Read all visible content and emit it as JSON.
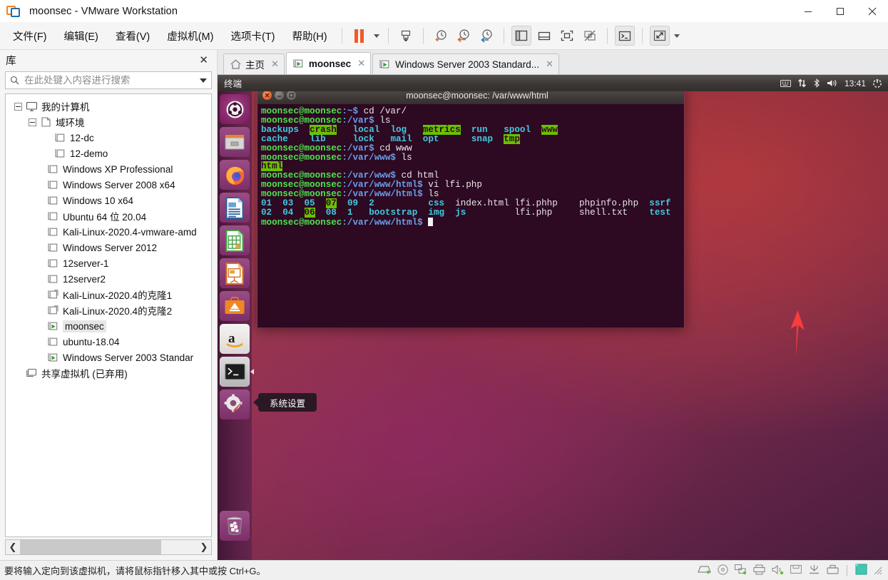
{
  "window": {
    "title": "moonsec - VMware Workstation",
    "logo_icon": "vmware-logo-icon",
    "controls": {
      "minimize": "minimize-icon",
      "maximize": "maximize-icon",
      "close": "close-icon"
    }
  },
  "menubar": {
    "items": [
      {
        "label": "文件(F)",
        "name": "menu-file"
      },
      {
        "label": "编辑(E)",
        "name": "menu-edit"
      },
      {
        "label": "查看(V)",
        "name": "menu-view"
      },
      {
        "label": "虚拟机(M)",
        "name": "menu-vm"
      },
      {
        "label": "选项卡(T)",
        "name": "menu-tabs"
      },
      {
        "label": "帮助(H)",
        "name": "menu-help"
      }
    ],
    "toolbar": [
      {
        "name": "suspend-button",
        "icon": "pause-icon"
      },
      {
        "name": "power-dropdown",
        "icon": "chevron-down-icon"
      },
      {
        "name": "snapshot-take-button",
        "icon": "snapshot-save-icon"
      },
      {
        "name": "snapshot-manager-button",
        "icon": "clock-plus-icon"
      },
      {
        "name": "revert-snapshot-button",
        "icon": "clock-back-icon"
      },
      {
        "name": "manage-snapshots-button",
        "icon": "clock-wrench-icon"
      },
      {
        "name": "show-library-button",
        "icon": "panel-left-icon"
      },
      {
        "name": "show-thumbnail-bar-button",
        "icon": "panel-bottom-icon"
      },
      {
        "name": "fullscreen-button",
        "icon": "fullscreen-icon"
      },
      {
        "name": "unity-mode-button",
        "icon": "unity-off-icon"
      },
      {
        "name": "console-button",
        "icon": "terminal-icon"
      },
      {
        "name": "stretch-button",
        "icon": "expand-arrows-icon"
      },
      {
        "name": "stretch-dropdown",
        "icon": "chevron-down-icon"
      }
    ]
  },
  "library": {
    "title": "库",
    "close_icon": "close-icon",
    "search": {
      "placeholder": "在此处键入内容进行搜索",
      "value": "",
      "icon": "search-icon",
      "dropdown_icon": "chevron-down-icon"
    },
    "tree": [
      {
        "label": "我的计算机",
        "depth": 0,
        "icon": "computer-icon",
        "expander": "minus",
        "selected": false
      },
      {
        "label": "域环境",
        "depth": 1,
        "icon": "folder-icon",
        "expander": "minus",
        "selected": false
      },
      {
        "label": "12-dc",
        "depth": 2,
        "icon": "vm-icon",
        "expander": "none",
        "selected": false
      },
      {
        "label": "12-demo",
        "depth": 2,
        "icon": "vm-icon",
        "expander": "none",
        "selected": false
      },
      {
        "label": "Windows XP Professional",
        "depth": 1.5,
        "icon": "vm-icon",
        "expander": "none",
        "selected": false
      },
      {
        "label": "Windows Server 2008 x64",
        "depth": 1.5,
        "icon": "vm-icon",
        "expander": "none",
        "selected": false
      },
      {
        "label": "Windows 10 x64",
        "depth": 1.5,
        "icon": "vm-icon",
        "expander": "none",
        "selected": false
      },
      {
        "label": "Ubuntu 64 位 20.04",
        "depth": 1.5,
        "icon": "vm-icon",
        "expander": "none",
        "selected": false
      },
      {
        "label": "Kali-Linux-2020.4-vmware-amd",
        "depth": 1.5,
        "icon": "vm-icon",
        "expander": "none",
        "selected": false
      },
      {
        "label": "Windows Server 2012",
        "depth": 1.5,
        "icon": "vm-icon",
        "expander": "none",
        "selected": false
      },
      {
        "label": "12server-1",
        "depth": 1.5,
        "icon": "vm-icon",
        "expander": "none",
        "selected": false
      },
      {
        "label": "12server2",
        "depth": 1.5,
        "icon": "vm-icon",
        "expander": "none",
        "selected": false
      },
      {
        "label": "Kali-Linux-2020.4的克隆1",
        "depth": 1.5,
        "icon": "vm-clone-icon",
        "expander": "none",
        "selected": false
      },
      {
        "label": "Kali-Linux-2020.4的克隆2",
        "depth": 1.5,
        "icon": "vm-clone-icon",
        "expander": "none",
        "selected": false
      },
      {
        "label": "moonsec",
        "depth": 1.5,
        "icon": "vm-running-icon",
        "expander": "none",
        "selected": true
      },
      {
        "label": "ubuntu-18.04",
        "depth": 1.5,
        "icon": "vm-icon",
        "expander": "none",
        "selected": false
      },
      {
        "label": "Windows Server 2003 Standar",
        "depth": 1.5,
        "icon": "vm-running-icon",
        "expander": "none",
        "selected": false
      },
      {
        "label": "共享虚拟机 (已弃用)",
        "depth": 0,
        "icon": "shared-vm-icon",
        "expander": "none",
        "selected": false
      }
    ],
    "hscroll": {
      "left_icon": "chevron-left-icon",
      "right_icon": "chevron-right-icon"
    }
  },
  "tabs": [
    {
      "label": "主页",
      "icon": "home-icon",
      "active": false,
      "close_icon": "close-icon"
    },
    {
      "label": "moonsec",
      "icon": "vm-running-icon",
      "active": true,
      "close_icon": "close-icon"
    },
    {
      "label": "Windows Server 2003 Standard...",
      "icon": "vm-running-icon",
      "active": false,
      "close_icon": "close-icon"
    }
  ],
  "guest": {
    "panel": {
      "app_name": "终端",
      "indicators": [
        {
          "name": "keyboard-indicator-icon"
        },
        {
          "name": "network-indicator-icon"
        },
        {
          "name": "bluetooth-indicator-icon"
        },
        {
          "name": "volume-indicator-icon"
        }
      ],
      "clock": "13:41",
      "session_icon": "power-gear-icon"
    },
    "launcher": [
      {
        "name": "launcher-ubuntu-dash",
        "icon": "ubuntu-dash-icon"
      },
      {
        "name": "launcher-files",
        "icon": "files-icon"
      },
      {
        "name": "launcher-firefox",
        "icon": "firefox-icon"
      },
      {
        "name": "launcher-libreoffice-writer",
        "icon": "writer-icon"
      },
      {
        "name": "launcher-libreoffice-calc",
        "icon": "calc-icon"
      },
      {
        "name": "launcher-libreoffice-impress",
        "icon": "impress-icon"
      },
      {
        "name": "launcher-ubuntu-software",
        "icon": "software-center-icon"
      },
      {
        "name": "launcher-amazon",
        "icon": "amazon-icon"
      },
      {
        "name": "launcher-terminal",
        "icon": "terminal-icon"
      },
      {
        "name": "launcher-system-settings",
        "icon": "system-settings-icon"
      },
      {
        "name": "launcher-trash",
        "icon": "trash-icon"
      }
    ],
    "tooltip": "系统设置",
    "terminal": {
      "title": "moonsec@moonsec: /var/www/html",
      "buttons": {
        "close": "close-icon",
        "minimize": "minimize-icon",
        "maximize": "maximize-icon"
      },
      "lines": [
        {
          "id": "l1",
          "prompt": "moonsec@moonsec",
          "path": ":~$",
          "cmd": " cd /var/"
        },
        {
          "id": "l2",
          "prompt": "moonsec@moonsec",
          "path": ":/var$",
          "cmd": " ls"
        },
        {
          "id": "l3",
          "type": "cols_var_1"
        },
        {
          "id": "l4",
          "type": "cols_var_2"
        },
        {
          "id": "l5",
          "prompt": "moonsec@moonsec",
          "path": ":/var$",
          "cmd": " cd www"
        },
        {
          "id": "l6",
          "prompt": "moonsec@moonsec",
          "path": ":/var/www$",
          "cmd": " ls"
        },
        {
          "id": "l7",
          "type": "html_dir"
        },
        {
          "id": "l8",
          "prompt": "moonsec@moonsec",
          "path": ":/var/www$",
          "cmd": " cd html"
        },
        {
          "id": "l9",
          "prompt": "moonsec@moonsec",
          "path": ":/var/www/html$",
          "cmd": " vi lfi.php"
        },
        {
          "id": "l10",
          "prompt": "moonsec@moonsec",
          "path": ":/var/www/html$",
          "cmd": " ls"
        },
        {
          "id": "l11",
          "type": "cols_html_1"
        },
        {
          "id": "l12",
          "type": "cols_html_2"
        },
        {
          "id": "l13",
          "prompt": "moonsec@moonsec",
          "path": ":/var/www/html$",
          "cmd": " ",
          "cursor": true
        }
      ],
      "var_listing_row1": [
        "backups",
        "crash",
        "local",
        "log",
        "metrics",
        "run",
        "spool",
        "www"
      ],
      "var_listing_row2": [
        "cache",
        "lib",
        "lock",
        "mail",
        "opt",
        "snap",
        "tmp"
      ],
      "www_listing": [
        "html"
      ],
      "html_listing_row1": [
        "01",
        "03",
        "05",
        "07",
        "09",
        "2",
        "css",
        "index.html",
        "lfi.phhp",
        "phpinfo.php",
        "ssrf"
      ],
      "html_listing_row2": [
        "02",
        "04",
        "06",
        "08",
        "1",
        "bootstrap",
        "img",
        "js",
        "lfi.php",
        "shell.txt",
        "test"
      ]
    },
    "annotation": {
      "name": "red-arrow-annotation",
      "color": "#fa3c3c"
    }
  },
  "statusbar": {
    "message": "要将输入定向到该虚拟机，请将鼠标指针移入其中或按 Ctrl+G。",
    "devices": [
      {
        "name": "status-harddisk-icon"
      },
      {
        "name": "status-cdrom-icon"
      },
      {
        "name": "status-network-icon"
      },
      {
        "name": "status-printer-icon"
      },
      {
        "name": "status-sound-icon"
      },
      {
        "name": "status-floppy-icon"
      },
      {
        "name": "status-usb-controller-icon"
      },
      {
        "name": "status-usb-device-icon"
      },
      {
        "name": "status-display-icon"
      },
      {
        "name": "status-resize-grip"
      }
    ]
  },
  "colors": {
    "accent_orange": "#f05a28",
    "vm_green": "#35a635",
    "terminal_bg": "#2d0922",
    "annotation_red": "#fa3c3c",
    "ubuntu_highlight": "#69c000"
  }
}
